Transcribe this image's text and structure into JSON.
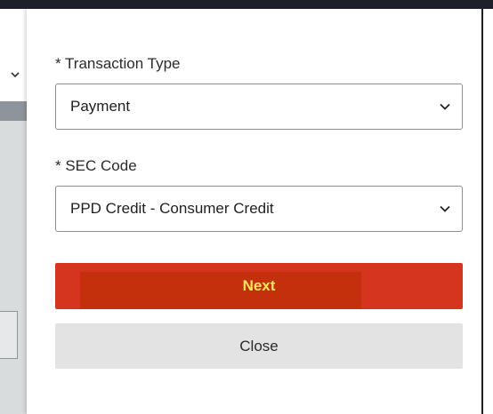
{
  "form": {
    "transaction_type": {
      "label": "* Transaction Type",
      "value": "Payment"
    },
    "sec_code": {
      "label": "* SEC Code",
      "value": "PPD Credit - Consumer Credit"
    }
  },
  "actions": {
    "next_label": "Next",
    "close_label": "Close"
  },
  "colors": {
    "next_bg": "#d5351f",
    "next_text": "#ffe65c",
    "close_bg": "#e3e3e3"
  },
  "icons": [
    "chevron-down-icon"
  ]
}
